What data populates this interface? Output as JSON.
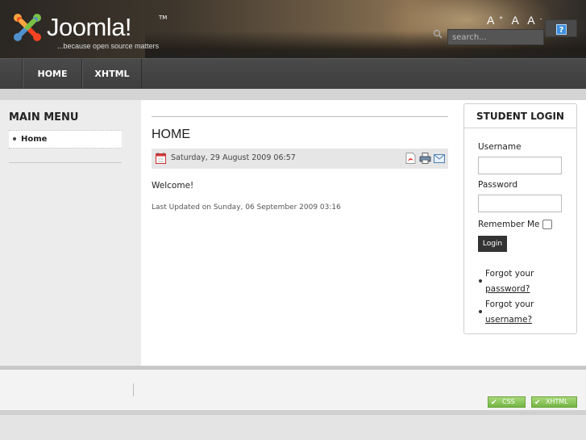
{
  "header": {
    "logo_word": "Joomla!",
    "logo_tm": "TM",
    "logo_slogan": "...because open source matters",
    "font_larger": "A",
    "font_larger_sup": "+",
    "font_reset": "A",
    "font_smaller": "A",
    "font_smaller_sup": "-",
    "search_placeholder": "search...",
    "help_label": "?"
  },
  "nav": {
    "items": [
      {
        "label": "HOME"
      },
      {
        "label": "XHTML"
      }
    ]
  },
  "sidebar": {
    "title": "MAIN MENU",
    "items": [
      {
        "label": "Home"
      }
    ]
  },
  "article": {
    "title": "HOME",
    "date": "Saturday, 29 August 2009 06:57",
    "body": "Welcome!",
    "last_updated": "Last Updated on Sunday, 06 September 2009 03:16"
  },
  "login": {
    "title": "STUDENT LOGIN",
    "username_label": "Username",
    "password_label": "Password",
    "remember_label": "Remember Me",
    "button_label": "Login",
    "forgot_password_prefix": "Forgot your",
    "forgot_password_link": "password?",
    "forgot_username_prefix": "Forgot your",
    "forgot_username_link": "username?"
  },
  "footer": {
    "badge_css": "CSS",
    "badge_xhtml": "XHTML"
  },
  "colors": {
    "header_bg": "#3f372d",
    "nav_bg": "#444444",
    "badge_green": "#74b544",
    "help_blue": "#3d8fe0"
  }
}
